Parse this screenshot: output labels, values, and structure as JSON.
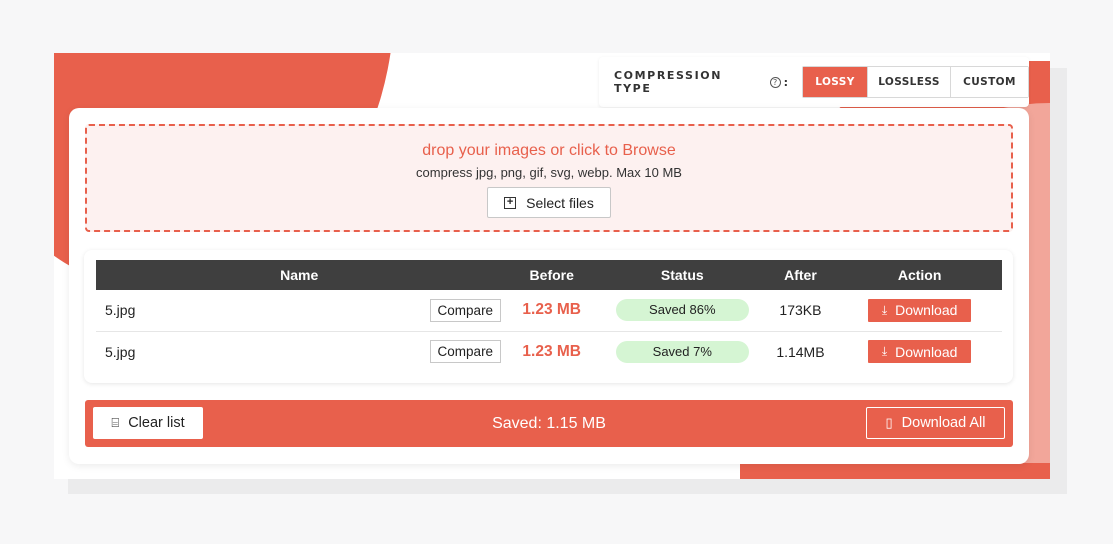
{
  "compression": {
    "label": "COMPRESSION TYPE",
    "help_glyph": "?",
    "colon": ":",
    "options": [
      "LOSSY",
      "LOSSLESS",
      "CUSTOM"
    ],
    "selected": "LOSSY"
  },
  "dropzone": {
    "title": "drop your images or click to Browse",
    "subtitle": "compress jpg, png, gif, svg, webp. Max 10 MB",
    "select_label": "Select files"
  },
  "table": {
    "headers": [
      "Name",
      "",
      "Before",
      "Status",
      "After",
      "Action"
    ],
    "rows": [
      {
        "name": "5.jpg",
        "compare": "Compare",
        "before": "1.23 MB",
        "status": "Saved 86%",
        "after": "173KB",
        "action": "Download"
      },
      {
        "name": "5.jpg",
        "compare": "Compare",
        "before": "1.23 MB",
        "status": "Saved 7%",
        "after": "1.14MB",
        "action": "Download"
      }
    ]
  },
  "footer": {
    "clear_label": "Clear list",
    "saved_text": "Saved: 1.15 MB",
    "download_all_label": "Download All"
  },
  "colors": {
    "accent": "#e8604c",
    "header_bg": "#3f3f3f",
    "status_bg": "#d5f5d3"
  }
}
